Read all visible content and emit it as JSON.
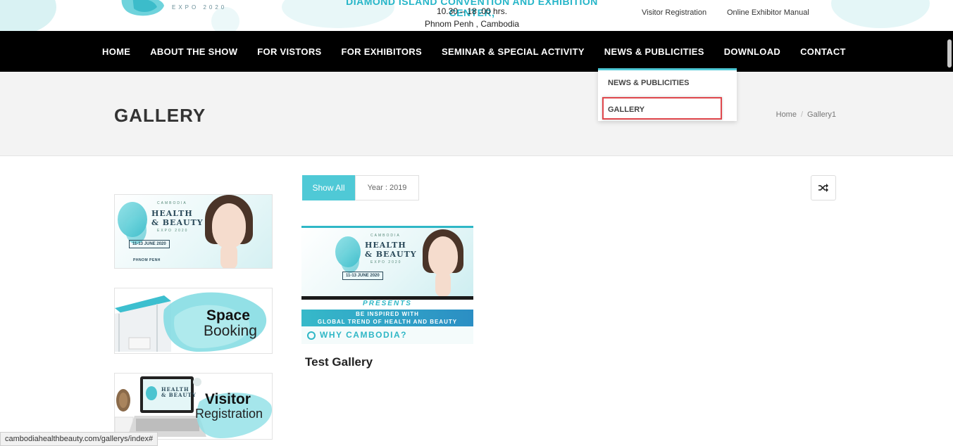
{
  "header": {
    "logo_sub": "EXPO 2020",
    "venue": "DIAMOND ISLAND CONVENTION AND EXHIBITION CENTER,",
    "time": "10.30 – 18 .00 hrs.",
    "city": "Phnom Penh , Cambodia",
    "links": [
      "Visitor Registration",
      "Online Exhibitor Manual"
    ]
  },
  "nav": {
    "items": [
      "HOME",
      "ABOUT THE SHOW",
      "FOR VISTORS",
      "FOR EXHIBITORS",
      "SEMINAR & SPECIAL ACTIVITY",
      "NEWS & PUBLICITIES",
      "DOWNLOAD",
      "CONTACT"
    ]
  },
  "dropdown": {
    "items": [
      "NEWS & PUBLICITIES",
      "GALLERY"
    ]
  },
  "page": {
    "title": "GALLERY",
    "breadcrumb": [
      "Home",
      "Gallery1"
    ]
  },
  "sidebar": {
    "banner1": {
      "small_top": "CAMBODIA",
      "line1": "HEALTH",
      "line2": "& BEAUTY",
      "small_bottom": "EXPO 2020",
      "date": "11-13 JUNE 2020",
      "place": "PHNOM PENH"
    },
    "banner2": {
      "line1": "Space",
      "line2": "Booking"
    },
    "banner3": {
      "line1": "Visitor",
      "line2": "Registration",
      "screen1": "HEALTH",
      "screen2": "& BEAUTY"
    }
  },
  "filters": {
    "all_label": "Show All",
    "year_label": "Year : 2019"
  },
  "gallery": {
    "card": {
      "small_top": "CAMBODIA",
      "line1": "HEALTH",
      "line2": "& BEAUTY",
      "small_bottom": "EXPO 2020",
      "date": "11-13 JUNE 2020",
      "presents": "PRESENTS",
      "band1": "BE INSPIRED WITH",
      "band2": "GLOBAL TREND OF HEALTH AND BEAUTY",
      "why": "WHY CAMBODIA?",
      "title": "Test Gallery"
    }
  },
  "status_bar": "cambodiahealthbeauty.com/gallerys/index#",
  "colors": {
    "accent": "#4fc9d6",
    "nav_bg": "#000000",
    "highlight": "#e0474c"
  }
}
